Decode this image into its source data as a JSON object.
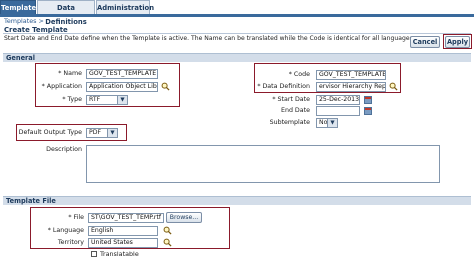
{
  "tabs": [
    {
      "label": "Templates",
      "active": true
    },
    {
      "label": "Data Definitions",
      "active": false
    },
    {
      "label": "Administration",
      "active": false
    }
  ],
  "breadcrumb": "Templates >",
  "page_title": "Create Template",
  "instructions": "Start Date and End Date define when the Template is active. The Name can be translated while the Code is identical for all languages.",
  "buttons": {
    "cancel": "Cancel",
    "apply": "Apply"
  },
  "general": {
    "section_title": "General",
    "name": {
      "label": "* Name",
      "value": "GOV_TEST_TEMPLATE"
    },
    "application": {
      "label": "* Application",
      "value": "Application Object Librar"
    },
    "type": {
      "label": "* Type",
      "value": "RTF"
    },
    "code": {
      "label": "* Code",
      "value": "GOV_TEST_TEMPLATE"
    },
    "data_definition": {
      "label": "* Data Definition",
      "value": "ervisor Hierarchy Report"
    },
    "start_date": {
      "label": "* Start Date",
      "value": "25-Dec-2013"
    },
    "end_date": {
      "label": "End Date",
      "value": ""
    },
    "subtemplate": {
      "label": "Subtemplate",
      "value": "No"
    },
    "default_output_type": {
      "label": "Default Output Type",
      "value": "PDF"
    },
    "description": {
      "label": "Description",
      "value": ""
    }
  },
  "template_file": {
    "section_title": "Template File",
    "file": {
      "label": "* File",
      "value": "ST\\GOV_TEST_TEMP.rtf",
      "browse": "Browse..."
    },
    "language": {
      "label": "* Language",
      "value": "English"
    },
    "territory": {
      "label": "Territory",
      "value": "United States"
    },
    "translatable": {
      "label": "Translatable",
      "checked": false
    }
  },
  "colors": {
    "accent": "#3a6a9c",
    "highlight_box": "#8b1a2b",
    "section_bg": "#d3dde9"
  },
  "icons": [
    "search-icon",
    "calendar-icon",
    "dropdown-arrow-icon",
    "checkbox-icon"
  ]
}
